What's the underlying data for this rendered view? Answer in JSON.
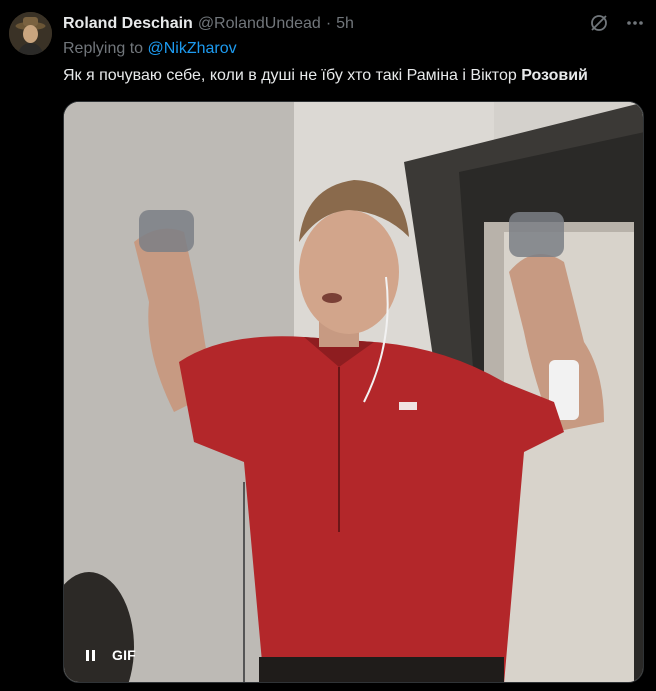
{
  "tweet": {
    "display_name": "Roland Deschain",
    "handle": "@RolandUndead",
    "separator": "·",
    "time": "5h",
    "replying_prefix": "Replying to",
    "replying_to": "@NikZharov",
    "text_main": "Як я почуваю себе, коли в душі не їбу хто такі Раміна і Віктор",
    "text_bold": "Розовий"
  },
  "media": {
    "type": "GIF",
    "badge": "GIF"
  },
  "icons": {
    "grok": "grok-icon",
    "more": "more-icon",
    "pause": "pause-icon"
  },
  "colors": {
    "background": "#000000",
    "text": "#e7e9ea",
    "muted": "#71767b",
    "link": "#1d9bf0",
    "shirt": "#b3272a"
  }
}
